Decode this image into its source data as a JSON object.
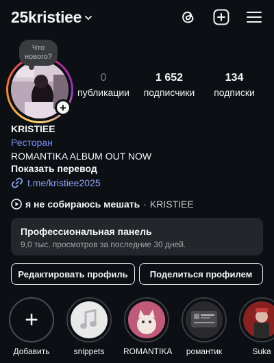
{
  "header": {
    "username": "25kristiee"
  },
  "note": {
    "text": "Что нового?"
  },
  "stats": {
    "posts": {
      "value": "0",
      "label": "публикации"
    },
    "followers": {
      "value": "1 652",
      "label": "подписчики"
    },
    "following": {
      "value": "134",
      "label": "подписки"
    }
  },
  "profile": {
    "name": "KRISTIEE",
    "category": "Ресторан",
    "bio": "ROMANTIKA ALBUM OUT NOW",
    "translate": "Показать перевод",
    "link": "t.me/kristiee2025"
  },
  "music": {
    "song": "я не собираюсь мешать",
    "separator": " · ",
    "artist": "KRISTIEE"
  },
  "dashboard": {
    "title": "Профессиональная панель",
    "subtitle": "9,0 тыс. просмотров за последние 30 дней."
  },
  "buttons": {
    "edit": "Редактировать профиль",
    "share": "Поделиться профилем"
  },
  "highlights": [
    {
      "label": "Добавить"
    },
    {
      "label": "snippets"
    },
    {
      "label": "ROMANTIKA"
    },
    {
      "label": "романтик"
    },
    {
      "label": "Suka"
    }
  ],
  "colors": {
    "background": "#0c1014",
    "link": "#8fa3f5",
    "category": "#7b8ef0",
    "panel": "#24262b"
  }
}
